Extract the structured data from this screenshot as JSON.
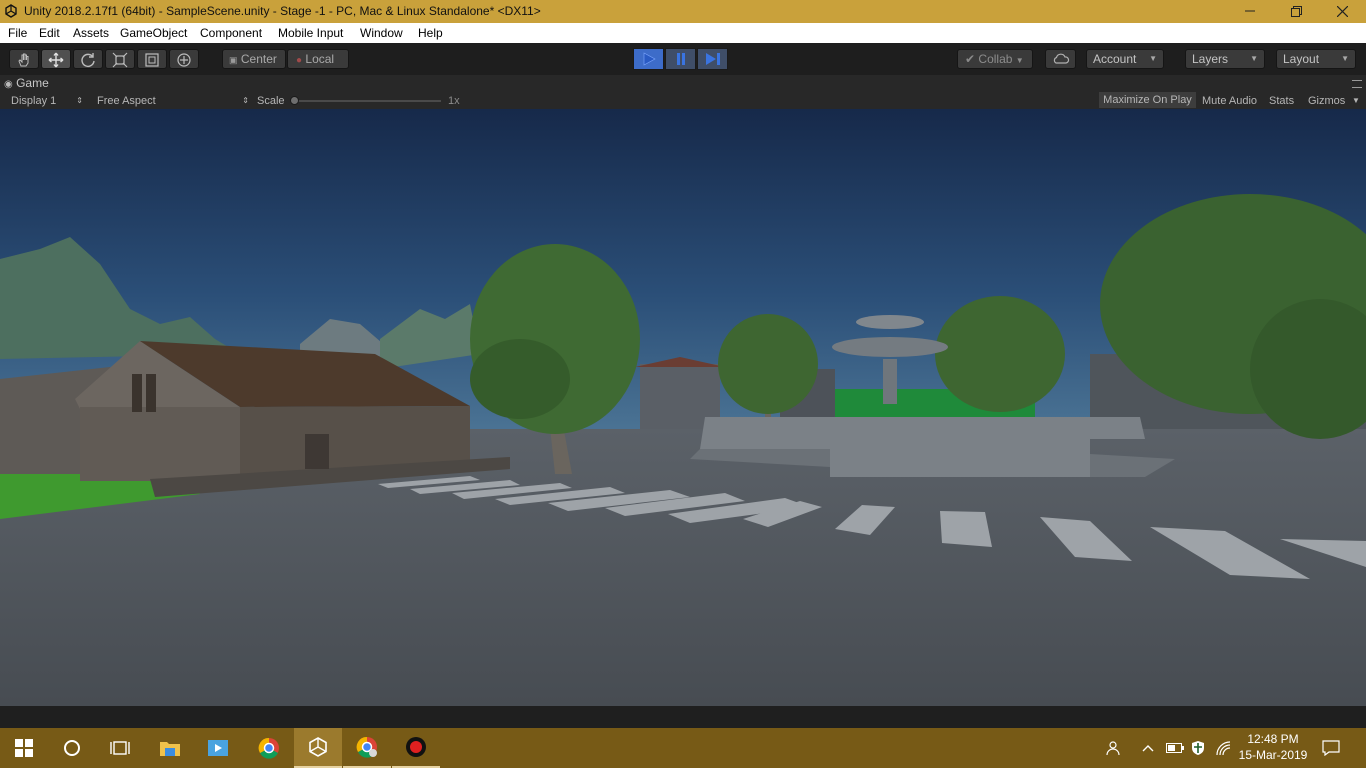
{
  "window": {
    "title": "Unity 2018.2.17f1 (64bit) - SampleScene.unity - Stage -1 - PC, Mac & Linux Standalone* <DX11>",
    "controls": [
      "minimize",
      "restore",
      "close"
    ]
  },
  "menubar": {
    "items": [
      "File",
      "Edit",
      "Assets",
      "GameObject",
      "Component",
      "Mobile Input",
      "Window",
      "Help"
    ]
  },
  "toolbar": {
    "tools": [
      "hand-tool",
      "move-tool",
      "rotate-tool",
      "scale-tool",
      "rect-tool",
      "transform-tool"
    ],
    "pivot_label": "Center",
    "space_label": "Local",
    "collab_label": "Collab",
    "account_label": "Account",
    "layers_label": "Layers",
    "layout_label": "Layout"
  },
  "game_view": {
    "tab_label": "Game",
    "display_label": "Display 1",
    "aspect_label": "Free Aspect",
    "scale_label": "Scale",
    "scale_value": "1x",
    "maximize_label": "Maximize On Play",
    "mute_label": "Mute Audio",
    "stats_label": "Stats",
    "gizmos_label": "Gizmos"
  },
  "taskbar": {
    "apps": [
      "start-icon",
      "cortana-icon",
      "task-view-icon",
      "file-explorer-icon",
      "media-player-icon",
      "chrome-icon",
      "unity-icon",
      "chrome-profile-icon",
      "record-icon"
    ],
    "time": "12:48 PM",
    "date": "15-Mar-2019"
  },
  "colors": {
    "title_bar": "#c9a13b",
    "taskbar": "#775a16",
    "play_active": "#3d6cc9"
  }
}
